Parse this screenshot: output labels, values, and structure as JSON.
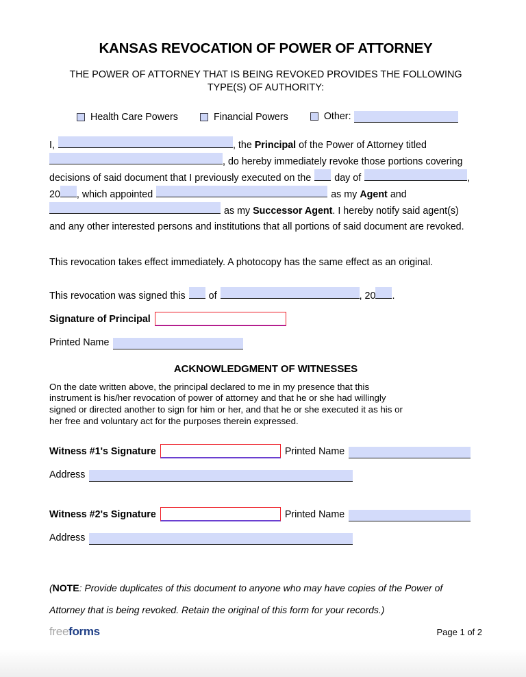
{
  "document": {
    "title": "KANSAS REVOCATION OF POWER OF ATTORNEY",
    "subtitle_line1": "THE POWER OF ATTORNEY THAT IS BEING REVOKED PROVIDES THE FOLLOWING",
    "subtitle_line2": "TYPE(S) OF AUTHORITY:"
  },
  "authority_types": {
    "health_care_label": "Health Care Powers",
    "financial_label": "Financial Powers",
    "other_label": "Other:",
    "other_value": ""
  },
  "body": {
    "l1_a": "I,",
    "l1_b": ", the",
    "l1_principal": "Principal",
    "l1_c": "of the Power of Attorney titled",
    "l2_a": ", do hereby immediately revoke those portions covering",
    "l3_a": "decisions of said document that I previously executed on the",
    "l3_b": "day of",
    "l3_c": ",",
    "l4_a": "20",
    "l4_b": ", which appointed",
    "l4_c": "as my",
    "l4_agent": "Agent",
    "l4_d": "and",
    "l5_a": "as my",
    "l5_successor": "Successor Agent",
    "l5_b": ". I hereby notify said agent(s)",
    "l6": "and any other interested persons and institutions that all portions of said document are revoked.",
    "effect_para": "This revocation takes effect immediately. A photocopy has the same effect as an original.",
    "signed_a": "This revocation was signed this",
    "signed_b": "of",
    "signed_c": ", 20",
    "signed_d": "."
  },
  "fields": {
    "principal_name": "",
    "poa_title": "",
    "day": "",
    "month": "",
    "year": "",
    "agent_name": "",
    "successor_agent_name": "",
    "signed_day": "",
    "signed_month": "",
    "signed_year": "",
    "principal_signature": "",
    "principal_printed_name": "",
    "witness1_signature": "",
    "witness1_printed_name": "",
    "witness1_address": "",
    "witness2_signature": "",
    "witness2_printed_name": "",
    "witness2_address": ""
  },
  "signature_section": {
    "signature_of_principal_label": "Signature of Principal",
    "printed_name_label": "Printed Name"
  },
  "acknowledgment": {
    "heading": "ACKNOWLEDGMENT OF WITNESSES",
    "line1": "On the date written above, the principal declared to me in my presence that this",
    "line2": "instrument is his/her revocation of power of attorney and that he or she had willingly",
    "line3": "signed or directed another to sign for him or her, and that he or she executed it as his or",
    "line4": "her free and voluntary act for the purposes therein expressed.",
    "witness1_label": "Witness #1's Signature",
    "witness2_label": "Witness #2's Signature",
    "printed_name_label": "Printed Name",
    "address_label": "Address"
  },
  "note": {
    "open_paren": "(",
    "bold_label": "NOTE",
    "line1": ": Provide duplicates of this document to anyone who may have copies of the Power of",
    "line2": "Attorney that is being revoked. Retain the original of this form for your records.)"
  },
  "footer": {
    "logo_free": "free",
    "logo_forms": "forms",
    "page_number": "Page 1 of 2"
  },
  "colors": {
    "field_fill": "#d3dbfa",
    "signature_border": "#ee1c25",
    "signature_underline_witness": "#6a3fd0",
    "signature_underline_principal": "#b41e8e",
    "logo_free": "#a6a6a6",
    "logo_forms": "#1f3f86"
  }
}
